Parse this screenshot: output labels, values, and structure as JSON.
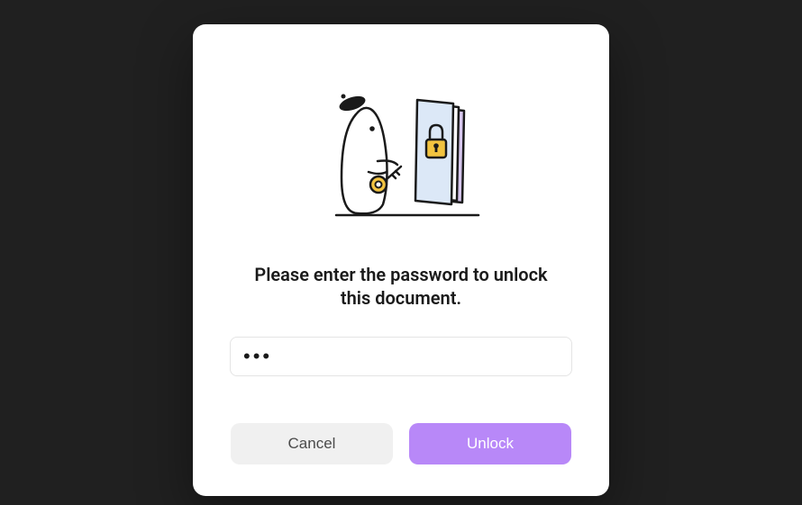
{
  "dialog": {
    "prompt": "Please enter the password to unlock this document.",
    "password_value": "•••",
    "buttons": {
      "cancel": "Cancel",
      "unlock": "Unlock"
    }
  }
}
